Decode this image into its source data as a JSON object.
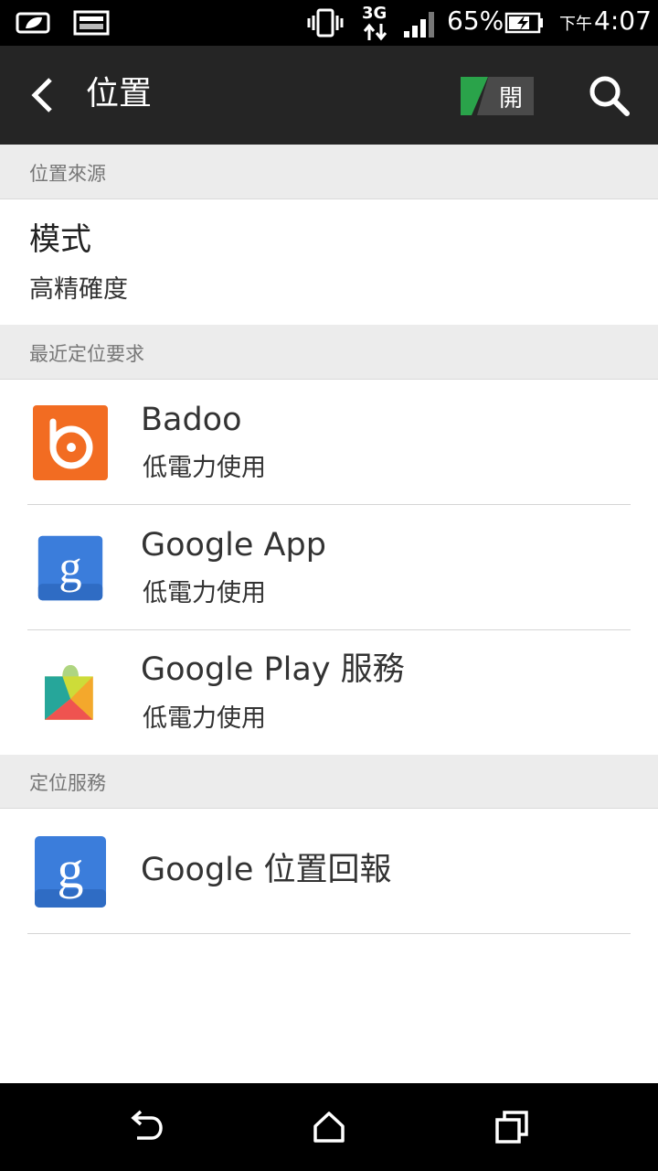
{
  "status_bar": {
    "network": "3G",
    "battery_percent": "65%",
    "time_ampm": "下午",
    "time": "4:07"
  },
  "action_bar": {
    "title": "位置",
    "toggle_label": "開"
  },
  "sections": {
    "location_source_header": "位置來源",
    "mode_title": "模式",
    "mode_value": "高精確度",
    "recent_requests_header": "最近定位要求",
    "location_services_header": "定位服務"
  },
  "recent_apps": [
    {
      "name": "Badoo",
      "usage": "低電力使用"
    },
    {
      "name": "Google App",
      "usage": "低電力使用"
    },
    {
      "name": "Google Play 服務",
      "usage": "低電力使用"
    }
  ],
  "services": [
    {
      "name": "Google 位置回報"
    }
  ],
  "colors": {
    "action_bar_bg": "#252525",
    "toggle_on": "#2aa34a",
    "badoo_orange": "#f26c22",
    "google_blue": "#3b7ddb"
  }
}
